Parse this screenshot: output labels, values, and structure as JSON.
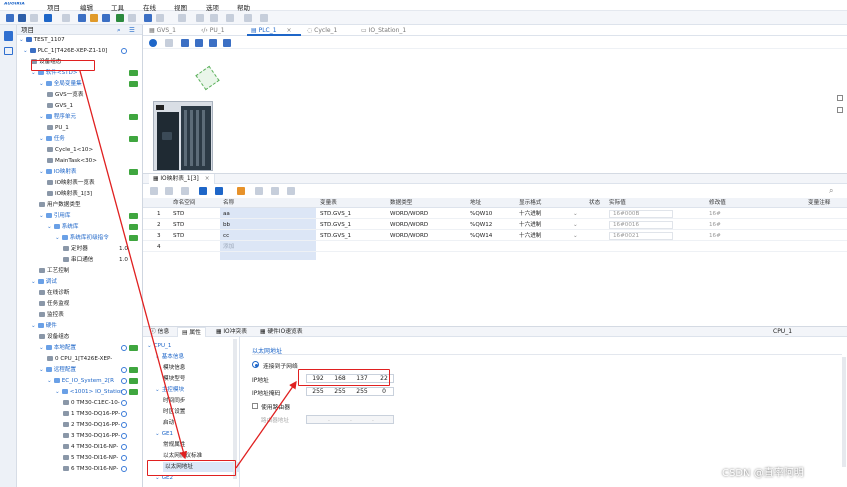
{
  "app": {
    "logo": "ᴬᵁᴼᴵᴿᴵᴬ"
  },
  "menu": [
    "项目",
    "编辑",
    "工具",
    "在线",
    "视图",
    "选项",
    "帮助"
  ],
  "project_panel": {
    "title": "项目",
    "items": [
      {
        "label": "TEST_1107",
        "type": "root"
      },
      {
        "label": "PLC_1[T426E-XEP-Z1-10]",
        "type": "plc"
      },
      {
        "label": "设备组态",
        "type": "leaf"
      },
      {
        "label": "软件<STD>",
        "type": "group"
      },
      {
        "label": "全局变量集",
        "type": "group"
      },
      {
        "label": "GVS一览表",
        "type": "leaf"
      },
      {
        "label": "GVS_1",
        "type": "leaf"
      },
      {
        "label": "程序单元",
        "type": "group"
      },
      {
        "label": "PU_1",
        "type": "leaf"
      },
      {
        "label": "任务",
        "type": "group"
      },
      {
        "label": "Cycle_1<10>",
        "type": "leaf"
      },
      {
        "label": "MainTask<30>",
        "type": "leaf"
      },
      {
        "label": "IO映射表",
        "type": "group"
      },
      {
        "label": "IO映射表一览表",
        "type": "leaf"
      },
      {
        "label": "IO映射表_1[3]",
        "type": "leaf"
      },
      {
        "label": "用户数据类型",
        "type": "leaf"
      },
      {
        "label": "引用库",
        "type": "group"
      },
      {
        "label": "系统库",
        "type": "group"
      },
      {
        "label": "系统库初级指令",
        "type": "group"
      },
      {
        "label": "定时器",
        "type": "leaf",
        "version": "1.0"
      },
      {
        "label": "串口通信",
        "type": "leaf",
        "version": "1.0"
      },
      {
        "label": "工艺控制",
        "type": "leaf"
      },
      {
        "label": "调试",
        "type": "group"
      },
      {
        "label": "在线诊断",
        "type": "leaf"
      },
      {
        "label": "任务监视",
        "type": "leaf"
      },
      {
        "label": "监控表",
        "type": "leaf"
      },
      {
        "label": "硬件",
        "type": "group"
      },
      {
        "label": "设备组态",
        "type": "leaf"
      },
      {
        "label": "本地配置",
        "type": "group"
      },
      {
        "label": "0 CPU_1[T426E-XEP-",
        "type": "leaf"
      },
      {
        "label": "远程配置",
        "type": "group"
      },
      {
        "label": "EC_IO_System_2[R",
        "type": "group"
      },
      {
        "label": "<1001> IO_Station",
        "type": "group"
      },
      {
        "label": "0 TM30-C1EC-10-",
        "type": "leaf"
      },
      {
        "label": "1 TM30-DQ16-PP-",
        "type": "leaf"
      },
      {
        "label": "2 TM30-DQ16-PP-",
        "type": "leaf"
      },
      {
        "label": "3 TM30-DQ16-PP-",
        "type": "leaf"
      },
      {
        "label": "4 TM30-DI16-NP-",
        "type": "leaf"
      },
      {
        "label": "5 TM30-DI16-NP-",
        "type": "leaf"
      },
      {
        "label": "6 TM30-DI16-NP-",
        "type": "leaf"
      }
    ]
  },
  "doc_tabs": [
    "GVS_1",
    "PU_1",
    "PLC_1",
    "Cycle_1",
    "IO_Station_1"
  ],
  "io_tab": {
    "label": "IO映射表_1[3]"
  },
  "io_table": {
    "headers": [
      "命名空间",
      "名称",
      "变量表",
      "数据类型",
      "地址",
      "显示格式",
      "状态",
      "实际值",
      "修改值",
      "变量注释"
    ],
    "rows": [
      {
        "no": "1",
        "ns": "STD",
        "name": "aa",
        "table": "STD.GVS_1",
        "type": "WORD/WORD",
        "addr": "%QW10",
        "fmt": "十六进制",
        "actual": "16#000B",
        "mod": "16#"
      },
      {
        "no": "2",
        "ns": "STD",
        "name": "bb",
        "table": "STD.GVS_1",
        "type": "WORD/WORD",
        "addr": "%QW12",
        "fmt": "十六进制",
        "actual": "16#0016",
        "mod": "16#"
      },
      {
        "no": "3",
        "ns": "STD",
        "name": "cc",
        "table": "STD.GVS_1",
        "type": "WORD/WORD",
        "addr": "%QW14",
        "fmt": "十六进制",
        "actual": "16#0021",
        "mod": "16#"
      },
      {
        "no": "4",
        "ns": "",
        "name": "添加",
        "table": "",
        "type": "",
        "addr": "",
        "fmt": "",
        "actual": "",
        "mod": ""
      }
    ]
  },
  "prop_tabs": [
    "信息",
    "属性",
    "IO冲突表",
    "硬件IO速览表"
  ],
  "prop_device": "CPU_1",
  "prop_nav": [
    {
      "label": "CPU_1",
      "level": 0,
      "group": true
    },
    {
      "label": "基本信息",
      "level": 1,
      "group": true
    },
    {
      "label": "模块信息",
      "level": 2
    },
    {
      "label": "模块型号",
      "level": 2
    },
    {
      "label": "主控模块",
      "level": 1,
      "group": true
    },
    {
      "label": "时间同步",
      "level": 2
    },
    {
      "label": "时区设置",
      "level": 2
    },
    {
      "label": "启动",
      "level": 2
    },
    {
      "label": "GE1",
      "level": 1,
      "group": true
    },
    {
      "label": "常规属性",
      "level": 2
    },
    {
      "label": "以太网协议标准",
      "level": 2
    },
    {
      "label": "以太网地址",
      "level": 2,
      "selected": true
    },
    {
      "label": "GE2",
      "level": 1,
      "group": true
    }
  ],
  "ethernet": {
    "section_title": "以太网地址",
    "radio_label": "连接到子网络",
    "ip_label": "IP地址",
    "ip": [
      "192",
      "168",
      "137",
      "22"
    ],
    "mask_label": "IP地址掩码",
    "mask": [
      "255",
      "255",
      "255",
      "0"
    ],
    "router_label": "使用路由器",
    "router_addr_label": "路由器地址",
    "router_addr": [
      ".",
      ".",
      "."
    ]
  },
  "watermark": "CSDN @直率阿明"
}
